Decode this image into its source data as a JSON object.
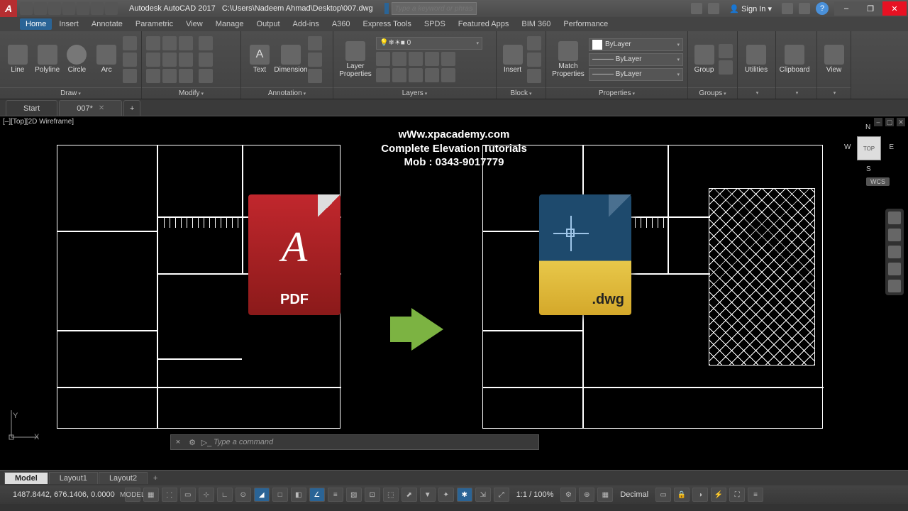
{
  "titlebar": {
    "app_logo": "A",
    "title_app": "Autodesk AutoCAD 2017",
    "title_path": "C:\\Users\\Nadeem Ahmad\\Desktop\\007.dwg",
    "search_placeholder": "Type a keyword or phrase",
    "signin": "Sign In",
    "help": "?"
  },
  "menus": [
    "Home",
    "Insert",
    "Annotate",
    "Parametric",
    "View",
    "Manage",
    "Output",
    "Add-ins",
    "A360",
    "Express Tools",
    "SPDS",
    "Featured Apps",
    "BIM 360",
    "Performance"
  ],
  "ribbon": {
    "draw": {
      "title": "Draw",
      "btns": [
        "Line",
        "Polyline",
        "Circle",
        "Arc"
      ]
    },
    "modify": {
      "title": "Modify"
    },
    "annotation": {
      "title": "Annotation",
      "btns": [
        "Text",
        "Dimension"
      ]
    },
    "layers": {
      "title": "Layers",
      "btn": "Layer\nProperties",
      "current": "0"
    },
    "block": {
      "title": "Block",
      "btn": "Insert"
    },
    "properties": {
      "title": "Properties",
      "btn": "Match\nProperties",
      "color": "ByLayer",
      "lw": "ByLayer",
      "lt": "ByLayer"
    },
    "groups": {
      "title": "Groups",
      "btn": "Group"
    },
    "utilities": {
      "title": "Utilities"
    },
    "clipboard": {
      "title": "Clipboard"
    },
    "view": {
      "title": "View"
    }
  },
  "filetabs": {
    "start": "Start",
    "doc": "007*",
    "plus": "+"
  },
  "viewport": {
    "label": "[–][Top][2D Wireframe]",
    "cube": "TOP",
    "n": "N",
    "s": "S",
    "e": "E",
    "w": "W",
    "wcs": "WCS",
    "ucs_y": "Y",
    "ucs_x": "X"
  },
  "overlay": {
    "line1": "wWw.xpacademy.com",
    "line2": "Complete Elevation Tutorials",
    "line3": "Mob : 0343-9017779"
  },
  "pdf": {
    "logo": "A",
    "label": "PDF"
  },
  "dwg": {
    "label": ".dwg"
  },
  "cmd": {
    "placeholder": "Type a command",
    "x": "×"
  },
  "layouts": [
    "Model",
    "Layout1",
    "Layout2"
  ],
  "status": {
    "coords": "1487.8442, 676.1406, 0.0000",
    "model": "MODEL",
    "scale": "1:1 / 100%",
    "units": "Decimal"
  }
}
